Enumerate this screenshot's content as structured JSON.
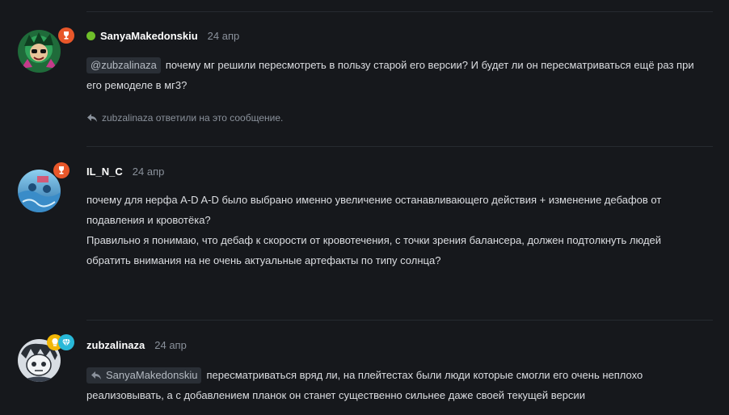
{
  "posts": [
    {
      "username": "SanyaMakedonskiu",
      "date": "24 апр",
      "online": true,
      "mention": "@zubzalinaza",
      "text": "почему мг решили пересмотреть в пользу старой его версии? И будет ли он пересматриваться ещё раз при его ремоделе в мг3?",
      "replied_note": "zubzalinaza ответили на это сообщение.",
      "badge_icons": [
        "trophy-icon"
      ],
      "badge_color": "#e8572a"
    },
    {
      "username": "IL_N_C",
      "date": "24 апр",
      "online": false,
      "paragraph1": "почему для нерфа A-D A-D было выбрано именно увеличение останавливающего действия + изменение дебафов от подавления и кровотёка?",
      "paragraph2": "Правильно я понимаю, что дебаф к скорости от кровотечения, с точки зрения балансера, должен подтолкнуть людей обратить внимания на не очень актуальные артефакты по типу солнца?",
      "badge_icons": [
        "trophy-icon"
      ],
      "badge_color": "#e8572a"
    },
    {
      "username": "zubzalinaza",
      "date": "24 апр",
      "online": false,
      "reply_to": "SanyaMakedonskiu",
      "text": "пересматриваться вряд ли, на плейтестах были люди которые смогли его очень неплохо реализовывать, а с добавлением планок он станет существенно сильнее даже своей текущей версии",
      "badge_icons": [
        "lightbulb-icon",
        "diamond-icon"
      ],
      "badge_colors": [
        "#f2b705",
        "#28b8d8"
      ]
    }
  ],
  "colors": {
    "background": "#16181c",
    "online": "#6fbf2a",
    "text": "#dcdee2",
    "muted": "#8a919b"
  }
}
